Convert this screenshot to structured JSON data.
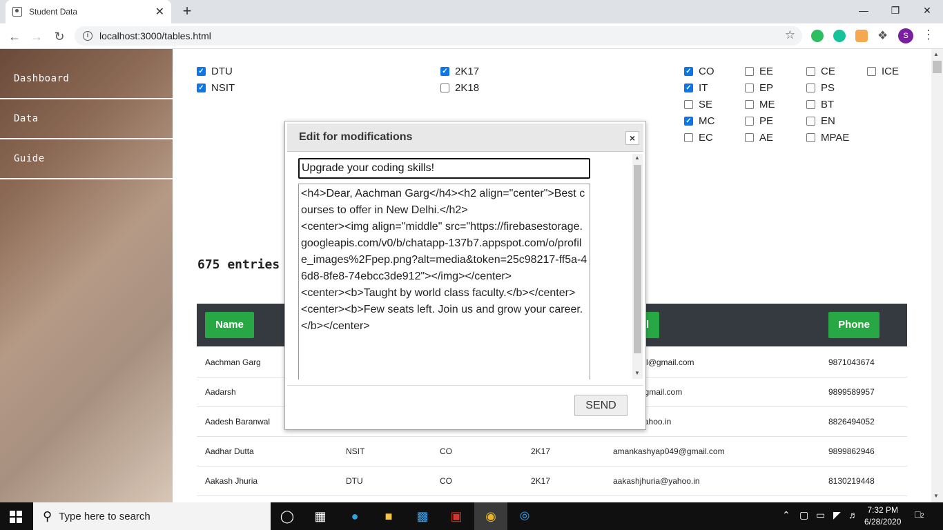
{
  "browser": {
    "tab_title": "Student Data",
    "url": "localhost:3000/tables.html",
    "profile_initial": "S"
  },
  "sidebar": {
    "items": [
      {
        "label": "Dashboard"
      },
      {
        "label": "Data"
      },
      {
        "label": "Guide"
      }
    ]
  },
  "filters": {
    "colleges": [
      {
        "label": "DTU",
        "checked": true
      },
      {
        "label": "NSIT",
        "checked": true
      }
    ],
    "years": [
      {
        "label": "2K17",
        "checked": true
      },
      {
        "label": "2K18",
        "checked": false
      }
    ],
    "branches": [
      {
        "label": "CO",
        "checked": true
      },
      {
        "label": "IT",
        "checked": true
      },
      {
        "label": "SE",
        "checked": false
      },
      {
        "label": "MC",
        "checked": true
      },
      {
        "label": "EC",
        "checked": false
      },
      {
        "label": "EE",
        "checked": false
      },
      {
        "label": "EP",
        "checked": false
      },
      {
        "label": "ME",
        "checked": false
      },
      {
        "label": "PE",
        "checked": false
      },
      {
        "label": "AE",
        "checked": false
      },
      {
        "label": "CE",
        "checked": false
      },
      {
        "label": "PS",
        "checked": false
      },
      {
        "label": "BT",
        "checked": false
      },
      {
        "label": "EN",
        "checked": false
      },
      {
        "label": "MPAE",
        "checked": false
      },
      {
        "label": "ICE",
        "checked": false
      }
    ]
  },
  "entries_text": "675 entries",
  "table": {
    "headers": {
      "name": "Name",
      "email_partial": "l",
      "phone": "Phone"
    },
    "rows": [
      {
        "name": "Aachman Garg",
        "college": "",
        "branch": "",
        "year": "",
        "email": "bisherwal@gmail.com",
        "phone": "9871043674"
      },
      {
        "name": "Aadarsh",
        "college": "",
        "branch": "",
        "year": "",
        "email": "rost21@gmail.com",
        "phone": "9899589957"
      },
      {
        "name": "Aadesh Baranwal",
        "college": "",
        "branch": "",
        "year": "",
        "email": "4914@yahoo.in",
        "phone": "8826494052"
      },
      {
        "name": "Aadhar Dutta",
        "college": "NSIT",
        "branch": "CO",
        "year": "2K17",
        "email": "amankashyap049@gmail.com",
        "phone": "9899862946"
      },
      {
        "name": "Aakash Jhuria",
        "college": "DTU",
        "branch": "CO",
        "year": "2K17",
        "email": "aakashjhuria@yahoo.in",
        "phone": "8130219448"
      }
    ]
  },
  "modal": {
    "title": "Edit for modifications",
    "close_glyph": "×",
    "subject_value": "Upgrade your coding skills!",
    "body_value": "<h4>Dear, Aachman Garg</h4><h2 align=\"center\">Best courses to offer in New Delhi.</h2>\n<center><img align=\"middle\" src=\"https://firebasestorage.googleapis.com/v0/b/chatapp-137b7.appspot.com/o/profile_images%2Fpep.png?alt=media&token=25c98217-ff5a-46d8-8fe8-74ebcc3de912\"></img></center>\n<center><b>Taught by world class faculty.</b></center>\n<center><b>Few seats left. Join us and grow your career.</b></center>",
    "send_label": "SEND"
  },
  "taskbar": {
    "search_placeholder": "Type here to search",
    "time": "7:32 PM",
    "date": "6/28/2020",
    "notification_count": "2"
  }
}
